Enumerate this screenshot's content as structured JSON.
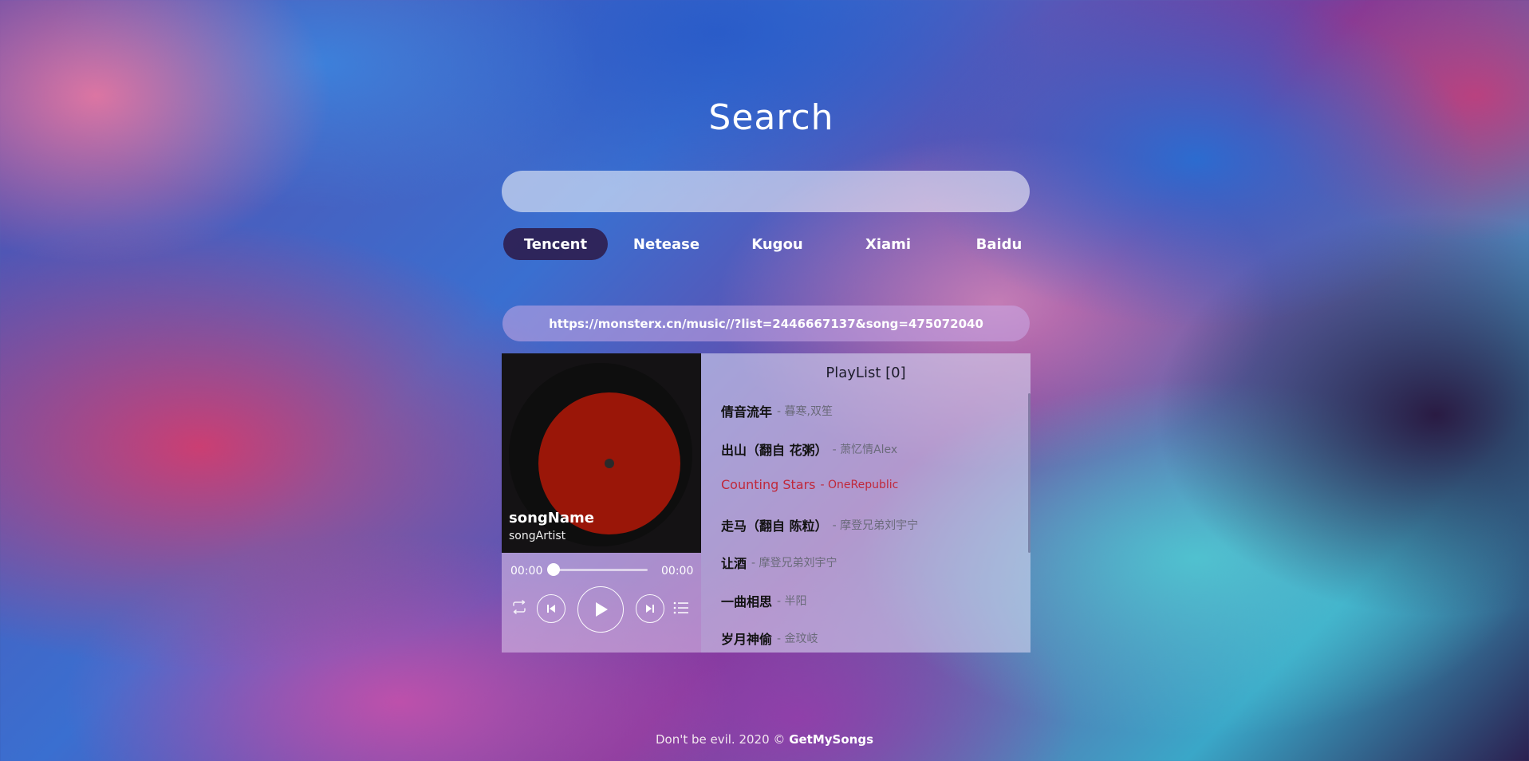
{
  "header": {
    "title": "Search"
  },
  "search": {
    "placeholder": "",
    "value": ""
  },
  "sources": [
    {
      "label": "Tencent",
      "active": true
    },
    {
      "label": "Netease",
      "active": false
    },
    {
      "label": "Kugou",
      "active": false
    },
    {
      "label": "Xiami",
      "active": false
    },
    {
      "label": "Baidu",
      "active": false
    }
  ],
  "share_url": "https://monsterx.cn/music//?list=2446667137&song=475072040",
  "player": {
    "song_name": "songName",
    "song_artist": "songArtist",
    "current_time": "00:00",
    "total_time": "00:00",
    "progress": 0,
    "icons": [
      "repeat-icon",
      "previous-icon",
      "play-icon",
      "next-icon",
      "playlist-icon"
    ]
  },
  "playlist": {
    "title": "PlayList [0]",
    "separator": "- ",
    "items": [
      {
        "name": "倩音流年",
        "artist": "暮寒,双笙"
      },
      {
        "name": "出山（翻自 花粥）",
        "artist": "萧忆情Alex"
      },
      {
        "name": "Counting Stars",
        "artist": "OneRepublic",
        "playing": true
      },
      {
        "name": "走马（翻自 陈粒）",
        "artist": "摩登兄弟刘宇宁"
      },
      {
        "name": "让酒",
        "artist": "摩登兄弟刘宇宁"
      },
      {
        "name": "一曲相思",
        "artist": "半阳"
      },
      {
        "name": "岁月神偷",
        "artist": "金玟岐"
      }
    ],
    "accent_color": "#c0283a"
  },
  "footer": {
    "text": "Don't be evil. 2020 © ",
    "brand": "GetMySongs"
  }
}
